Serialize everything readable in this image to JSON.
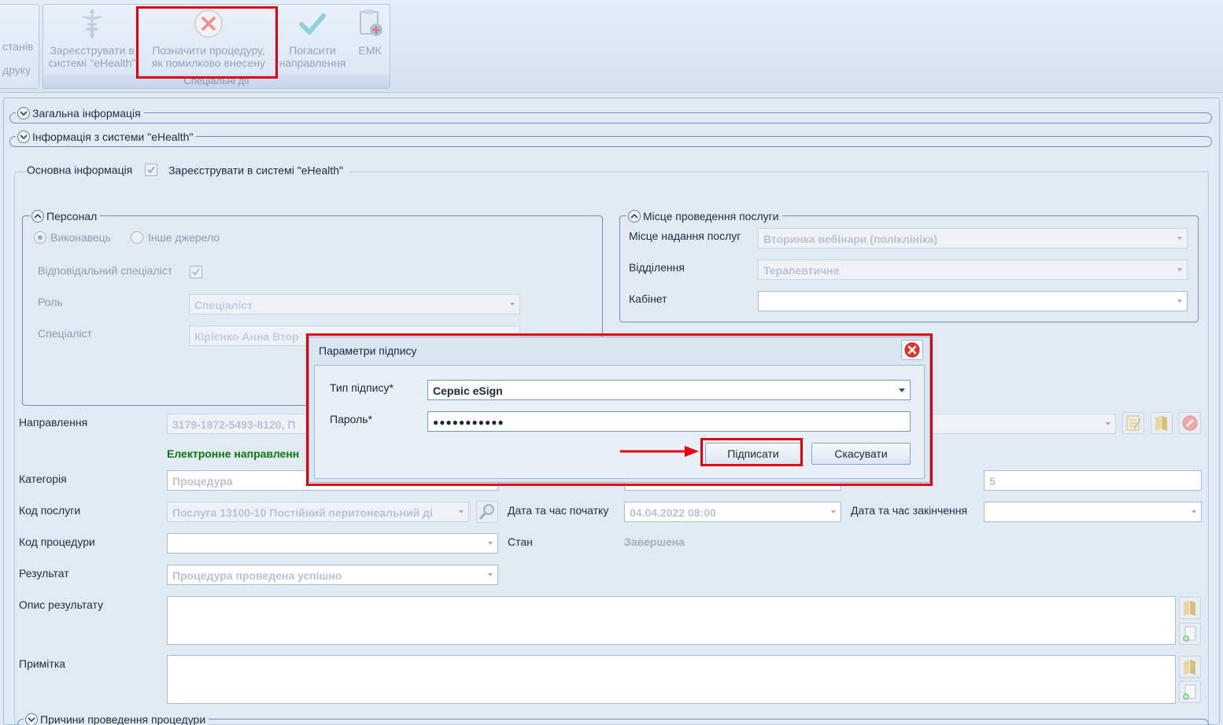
{
  "ribbon": {
    "partial_group": {
      "line1": "станів",
      "line2": "друку"
    },
    "special_group": {
      "caption": "Спеціальні дії",
      "register": {
        "line1": "Зареєструвати в",
        "line2": "системі \"eHealth\""
      },
      "mark_error": {
        "line1": "Позначити процедуру,",
        "line2": "як помилково внесену"
      },
      "repay": {
        "line1": "Погасити",
        "line2": "направлення"
      },
      "emk": {
        "line1": "ЕМК"
      }
    }
  },
  "sections": {
    "general": "Загальна інформація",
    "ehealth_info": "Інформація з системи \"eHealth\"",
    "main_info": "Основна інформація",
    "register_label": "Зареєструвати в системі \"eHealth\"",
    "register_checked": true,
    "reasons": "Причини проведення процедури"
  },
  "personnel": {
    "title": "Персонал",
    "radio_executor": "Виконавець",
    "radio_other": "Інше джерело",
    "selected": "executor",
    "responsible_label": "Відповідальний спеціаліст",
    "responsible_checked": true,
    "role_label": "Роль",
    "role_value": "Спеціаліст",
    "specialist_label": "Спеціаліст",
    "specialist_value": "Кірієнко Анна Втор"
  },
  "location": {
    "title": "Місце проведення послуги",
    "place_label": "Місце надання послуг",
    "place_value": "Вторинка вебінари (поліклініка)",
    "department_label": "Відділення",
    "department_value": "Терапевтичне",
    "cabinet_label": "Кабінет",
    "cabinet_value": ""
  },
  "form": {
    "referral_label": "Направлення",
    "referral_value": "3179-1872-5493-8120, П",
    "referral_note": "Електронне направленн",
    "category_label": "Категорія",
    "category_value": "Процедура",
    "right_field_value": "5",
    "service_code_label": "Код послуги",
    "service_code_value": "Послуга 13100-10 Постійний перитонеальний ді",
    "start_label": "Дата та час початку",
    "start_value": "04.04.2022 08:00",
    "end_label": "Дата та час закінчення",
    "end_value": "",
    "procedure_code_label": "Код процедури",
    "procedure_code_value": "",
    "status_label": "Стан",
    "status_value": "Завершена",
    "result_label": "Результат",
    "result_value": "Процедура проведена успішно",
    "result_desc_label": "Опис результату",
    "note_label": "Примітка"
  },
  "dialog": {
    "title": "Параметри підпису",
    "type_label": "Тип підпису*",
    "type_value": "Сервіс eSign",
    "password_label": "Пароль*",
    "password_value": "●●●●●●●●●●●",
    "sign_button": "Підписати",
    "cancel_button": "Скасувати"
  },
  "colors": {
    "highlight": "#e3000f",
    "ehealth_note": "#0a7a0a"
  }
}
